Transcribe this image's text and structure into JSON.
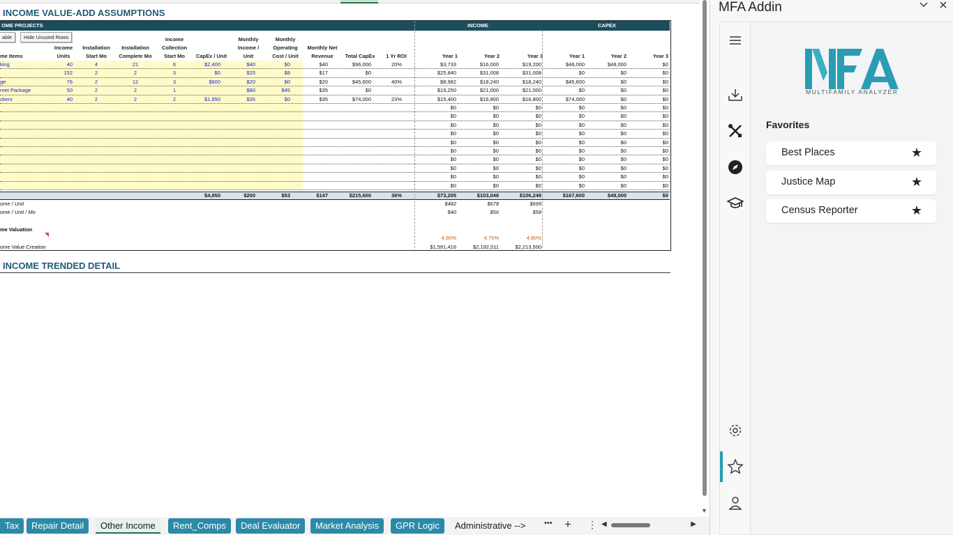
{
  "sheet": {
    "title": "INCOME VALUE-ADD ASSUMPTIONS",
    "section2_title": "INCOME TRENDED DETAIL",
    "table_bar": {
      "projects": "OME PROJECTS",
      "income": "INCOME",
      "capex": "CAPEX"
    },
    "buttons": {
      "table": "able",
      "hide_unused": "Hide Unused Rows"
    },
    "headers": {
      "items": "me Items",
      "income_units": [
        "Income",
        "Units"
      ],
      "install_start": [
        "Installation",
        "Start Mo"
      ],
      "install_complete": [
        "Installation",
        "Complete Mo"
      ],
      "income_collection": [
        "Income",
        "Collection",
        "Start Mo"
      ],
      "capex_unit": "CapEx / Unit",
      "monthly_income": [
        "Monthly",
        "Income /",
        "Unit"
      ],
      "monthly_operating": [
        "Monthly",
        "Operating",
        "Cost / Unit"
      ],
      "monthly_net": [
        "Monthly Net",
        "Revenue"
      ],
      "total_capex": "Total CapEx",
      "roi": "1 Yr ROI",
      "income_years": [
        "Year 1",
        "Year 2",
        "Year 3"
      ],
      "capex_years": [
        "Year 1",
        "Year 2",
        "Year 3"
      ]
    },
    "rows": [
      {
        "item": "king",
        "units": "40",
        "start": "4",
        "complete": "21",
        "collect": "6",
        "capex": "$2,400",
        "income": "$40",
        "opcost": "$0",
        "net": "$40",
        "total": "$96,000",
        "roi": "20%",
        "iy1": "$3,733",
        "iy2": "$16,000",
        "iy3": "$19,200",
        "cy1": "$48,000",
        "cy2": "$48,000",
        "cy3": "$0"
      },
      {
        "item": "",
        "units": "152",
        "start": "2",
        "complete": "2",
        "collect": "3",
        "capex": "$0",
        "income": "$25",
        "opcost": "$8",
        "net": "$17",
        "total": "$0",
        "roi": "",
        "iy1": "$25,840",
        "iy2": "$31,008",
        "iy3": "$31,008",
        "cy1": "$0",
        "cy2": "$0",
        "cy3": "$0"
      },
      {
        "item": "ge",
        "units": "76",
        "start": "2",
        "complete": "12",
        "collect": "3",
        "capex": "$600",
        "income": "$20",
        "opcost": "$0",
        "net": "$20",
        "total": "$45,600",
        "roi": "40%",
        "iy1": "$8,982",
        "iy2": "$18,240",
        "iy3": "$18,240",
        "cy1": "$45,600",
        "cy2": "$0",
        "cy3": "$0"
      },
      {
        "item": "rnet Package",
        "units": "50",
        "start": "2",
        "complete": "2",
        "collect": "1",
        "capex": "",
        "income": "$80",
        "opcost": "$45",
        "net": "$35",
        "total": "$0",
        "roi": "",
        "iy1": "$19,250",
        "iy2": "$21,000",
        "iy3": "$21,000",
        "cy1": "$0",
        "cy2": "$0",
        "cy3": "$0"
      },
      {
        "item": "ckers",
        "units": "40",
        "start": "2",
        "complete": "2",
        "collect": "2",
        "capex": "$1,850",
        "income": "$35",
        "opcost": "$0",
        "net": "$35",
        "total": "$74,000",
        "roi": "23%",
        "iy1": "$15,400",
        "iy2": "$16,800",
        "iy3": "$16,800",
        "cy1": "$74,000",
        "cy2": "$0",
        "cy3": "$0"
      }
    ],
    "empty_value": "$0",
    "totals": {
      "capex": "$4,850",
      "income": "$200",
      "opcost": "$53",
      "net": "$147",
      "total": "$215,600",
      "roi": "36%",
      "iy1": "$73,205",
      "iy2": "$103,048",
      "iy3": "$106,248",
      "cy1": "$167,600",
      "cy2": "$48,000",
      "cy3": "$0"
    },
    "per_unit": {
      "label": "ome / Unit",
      "y1": "$482",
      "y2": "$678",
      "y3": "$699"
    },
    "per_unit_mo": {
      "label": "ome / Unit / Mo",
      "y1": "$40",
      "y2": "$56",
      "y3": "$58"
    },
    "valuation": {
      "label": "me Valuation",
      "y1": "4.60%",
      "y2": "4.70%",
      "y3": "4.80%"
    },
    "value_creation": {
      "label": "ome Value Creation",
      "y1": "$1,591,416",
      "y2": "$2,192,511",
      "y3": "$2,213,500"
    }
  },
  "tabs": [
    {
      "label": "Tax",
      "state": "normal"
    },
    {
      "label": "Repair Detail",
      "state": "normal"
    },
    {
      "label": "Other Income",
      "state": "active"
    },
    {
      "label": "Rent_Comps",
      "state": "normal"
    },
    {
      "label": "Deal Evaluator",
      "state": "normal"
    },
    {
      "label": "Market Analysis",
      "state": "normal"
    },
    {
      "label": "GPR Logic",
      "state": "normal"
    },
    {
      "label": "Administrative -->",
      "state": "plain"
    }
  ],
  "tabbar_controls": {
    "more": "•••",
    "add": "+",
    "options": "⋮"
  },
  "pane": {
    "title": "MFA Addin",
    "logo_text": "MULTIFAMILY ANALYZER",
    "favorites_title": "Favorites",
    "favorites": [
      "Best Places",
      "Justice Map",
      "Census Reporter"
    ],
    "accent_color": "#2a9cb3",
    "rail_icons": [
      "menu-icon",
      "download-icon",
      "tools-icon",
      "compass-icon",
      "graduation-cap-icon",
      "gear-icon",
      "star-icon",
      "user-icon"
    ]
  }
}
